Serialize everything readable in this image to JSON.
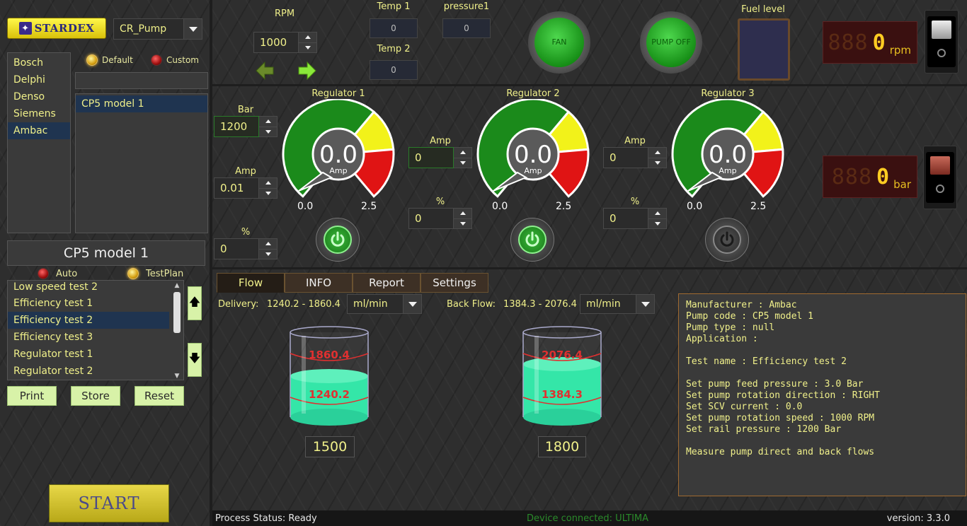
{
  "app": {
    "logo_text": "STARDEX",
    "pump_type": "CR_Pump"
  },
  "manufacturers": [
    "Bosch",
    "Delphi",
    "Denso",
    "Siemens",
    "Ambac"
  ],
  "manufacturer_selected": 4,
  "mode_options": {
    "default_label": "Default",
    "custom_label": "Custom"
  },
  "models": [
    "CP5 model 1"
  ],
  "model_search_value": "",
  "model_title": "CP5 model 1",
  "test_mode": {
    "auto_label": "Auto",
    "testplan_label": "TestPlan"
  },
  "tests": [
    "Low speed test 2",
    "Efficiency test 1",
    "Efficiency test 2",
    "Efficiency test 3",
    "Regulator test 1",
    "Regulator test 2"
  ],
  "test_selected": 2,
  "actions": {
    "print": "Print",
    "store": "Store",
    "reset": "Reset",
    "start": "START"
  },
  "top": {
    "rpm_label": "RPM",
    "rpm_value": "1000",
    "temp1_label": "Temp 1",
    "temp1_value": "0",
    "temp2_label": "Temp 2",
    "temp2_value": "0",
    "pressure1_label": "pressure1",
    "pressure1_value": "0",
    "fan_label": "FAN",
    "pump_label": "PUMP OFF",
    "fuel_label": "Fuel level",
    "rpm_display": "0",
    "rpm_unit": "rpm",
    "bar_display": "0",
    "bar_unit": "bar",
    "lcd_ghost": "888"
  },
  "regulators": [
    {
      "title": "Regulator 1",
      "value": "0.0",
      "unit": "Amp",
      "min": "0.0",
      "max": "2.5",
      "power": "on"
    },
    {
      "title": "Regulator 2",
      "value": "0.0",
      "unit": "Amp",
      "min": "0.0",
      "max": "2.5",
      "power": "on"
    },
    {
      "title": "Regulator 3",
      "value": "0.0",
      "unit": "Amp",
      "min": "0.0",
      "max": "2.5",
      "power": "off"
    }
  ],
  "controls": {
    "bar_label": "Bar",
    "bar_value": "1200",
    "amp_label": "Amp",
    "amp1_value": "0.01",
    "pct_label": "%",
    "pct1_value": "0",
    "amp2_value": "0",
    "pct2_value": "0",
    "amp3_value": "0",
    "pct3_value": "0"
  },
  "tabs": [
    "Flow",
    "INFO",
    "Report",
    "Settings"
  ],
  "tab_active": 0,
  "flow": {
    "delivery_label": "Delivery:",
    "delivery_range": "1240.2 - 1860.4",
    "delivery_unit": "ml/min",
    "backflow_label": "Back Flow:",
    "backflow_range": "1384.3 - 2076.4",
    "backflow_unit": "ml/min",
    "beaker1_upper": "1860.4",
    "beaker1_lower": "1240.2",
    "beaker1_value": "1500",
    "beaker2_upper": "2076.4",
    "beaker2_lower": "1384.3",
    "beaker2_value": "1800"
  },
  "info_text": "Manufacturer : Ambac\nPump code : CP5 model 1\nPump type : null\nApplication :\n\nTest name : Efficiency test 2\n\nSet pump feed pressure : 3.0 Bar\nSet pump rotation direction : RIGHT\nSet SCV current : 0.0\nSet pump rotation speed : 1000 RPM\nSet rail pressure : 1200 Bar\n\nMeasure pump direct and back flows",
  "status": {
    "process": "Process Status: Ready",
    "device": "Device connected: ULTIMA",
    "version": "version: 3.3.0"
  },
  "colors": {
    "accent_yellow": "#f0f08a",
    "gauge_green": "#1b8a1b",
    "gauge_yellow": "#f2f21a",
    "gauge_red": "#e01414",
    "fluid": "#34e6a8",
    "device_text": "#2a8a2a"
  }
}
